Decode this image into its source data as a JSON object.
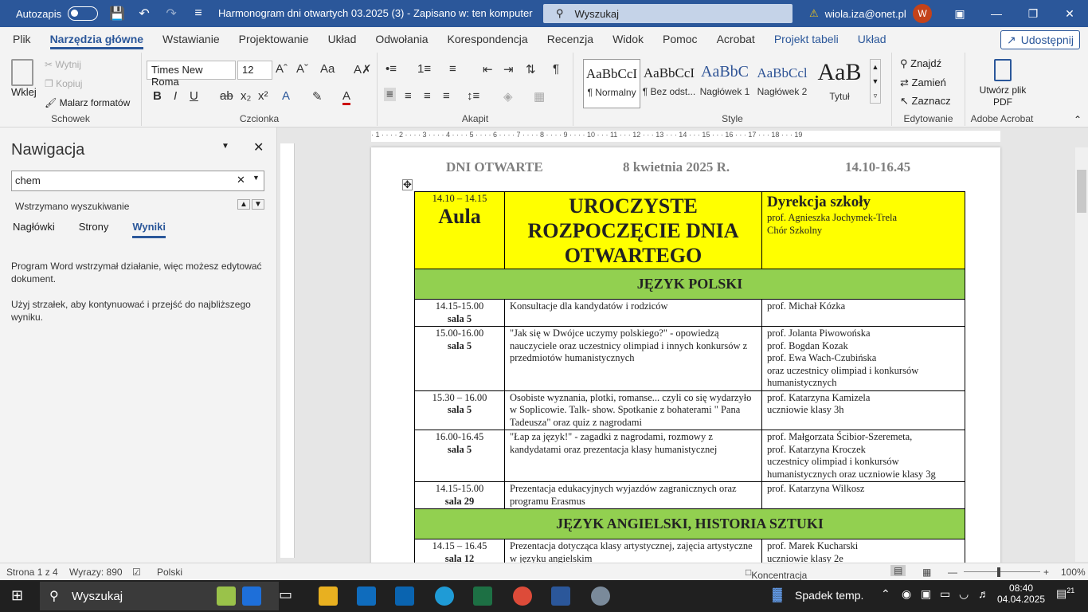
{
  "titlebar": {
    "autosave": "Autozapis",
    "title": "Harmonogram dni otwartych 03.2025 (3)  -  Zapisano w: ten komputer",
    "search": "Wyszukaj",
    "account": "wiola.iza@onet.pl",
    "avatar": "W"
  },
  "ribbon_tabs": [
    "Plik",
    "Narzędzia główne",
    "Wstawianie",
    "Projektowanie",
    "Układ",
    "Odwołania",
    "Korespondencja",
    "Recenzja",
    "Widok",
    "Pomoc",
    "Acrobat",
    "Projekt tabeli",
    "Układ"
  ],
  "share": "Udostępnij",
  "clipboard": {
    "paste": "Wklej",
    "cut": "Wytnij",
    "copy": "Kopiuj",
    "painter": "Malarz formatów",
    "label": "Schowek"
  },
  "font": {
    "name": "Times New Roma",
    "size": "12",
    "label": "Czcionka"
  },
  "paragraph": {
    "label": "Akapit"
  },
  "styles": {
    "items": [
      {
        "sample": "AaBbCcI",
        "name": "¶ Normalny"
      },
      {
        "sample": "AaBbCcI",
        "name": "¶ Bez odst..."
      },
      {
        "sample": "AaBbC",
        "name": "Nagłówek 1"
      },
      {
        "sample": "AaBbCcl",
        "name": "Nagłówek 2"
      },
      {
        "sample": "AaB",
        "name": "Tytuł"
      }
    ],
    "label": "Style"
  },
  "editing": {
    "find": "Znajdź",
    "replace": "Zamień",
    "select": "Zaznacz",
    "label": "Edytowanie"
  },
  "acrobat": {
    "create": "Utwórz plik PDF",
    "label": "Adobe Acrobat"
  },
  "nav": {
    "title": "Nawigacja",
    "search_value": "chem",
    "stopped": "Wstrzymano wyszukiwanie",
    "tabs": [
      "Nagłówki",
      "Strony",
      "Wyniki"
    ],
    "msg1": "Program Word wstrzymał działanie, więc możesz edytować dokument.",
    "msg2": "Użyj strzałek, aby kontynuować i przejść do najbliższego wyniku."
  },
  "doc": {
    "header_left": "DNI OTWARTE",
    "header_mid": "8 kwietnia 2025 R.",
    "header_right": "14.10-16.45",
    "opening": {
      "time": "14.10 – 14.15",
      "room": "Aula",
      "title": "UROCZYSTE ROZPOCZĘCIE DNIA OTWARTEGO",
      "who_title": "Dyrekcja szkoły",
      "who1": "prof. Agnieszka Jochymek-Trela",
      "who2": "Chór Szkolny"
    },
    "section1": "JĘZYK POLSKI",
    "rows1": [
      {
        "time": "14.15-15.00",
        "room": "sala 5",
        "desc": "Konsultacje dla kandydatów i rodziców",
        "who": "prof. Michał Kózka"
      },
      {
        "time": "15.00-16.00",
        "room": "sala 5",
        "desc": "\"Jak się w Dwójce uczymy polskiego?\" - opowiedzą nauczyciele oraz uczestnicy olimpiad i innych konkursów z przedmiotów humanistycznych",
        "who": "prof. Jolanta Piwowońska\nprof. Bogdan Kozak\nprof. Ewa Wach-Czubińska\noraz uczestnicy olimpiad i konkursów humanistycznych"
      },
      {
        "time": "15.30 – 16.00",
        "room": "sala 5",
        "desc": "Osobiste wyznania, plotki, romanse... czyli co się wydarzyło w Soplicowie. Talk- show. Spotkanie z bohaterami \" Pana Tadeusza\" oraz quiz z nagrodami",
        "who": "prof. Katarzyna Kamizela\nuczniowie klasy 3h"
      },
      {
        "time": "16.00-16.45",
        "room": "sala 5",
        "desc": "\"Łap za język!\" - zagadki z nagrodami, rozmowy z kandydatami oraz prezentacja klasy humanistycznej",
        "who": "prof. Małgorzata Ścibior-Szeremeta,\nprof. Katarzyna Kroczek\nuczestnicy olimpiad i konkursów humanistycznych oraz uczniowie klasy 3g"
      },
      {
        "time": "14.15-15.00",
        "room": "sala 29",
        "desc": "Prezentacja edukacyjnych wyjazdów zagranicznych oraz programu Erasmus",
        "who": "prof. Katarzyna Wilkosz"
      }
    ],
    "section2": "JĘZYK ANGIELSKI, HISTORIA SZTUKI",
    "rows2": [
      {
        "time": "14.15 – 16.45",
        "room": "sala 12",
        "desc": "Prezentacja dotycząca klasy artystycznej, zajęcia artystyczne w języku angielskim",
        "who": "prof. Marek Kucharski\nuczniowie klasy 2e"
      }
    ]
  },
  "status": {
    "page": "Strona 1 z 4",
    "words": "Wyrazy: 890",
    "lang": "Polski",
    "focus": "Koncentracja uwagi",
    "zoom": "100%"
  },
  "taskbar": {
    "search": "Wyszukaj",
    "weather": "Spadek temp.",
    "time": "08:40",
    "date": "04.04.2025",
    "notif": "21"
  },
  "colors": {
    "word_blue": "#2b579a",
    "yellow": "#ffff00",
    "green": "#92d050"
  }
}
